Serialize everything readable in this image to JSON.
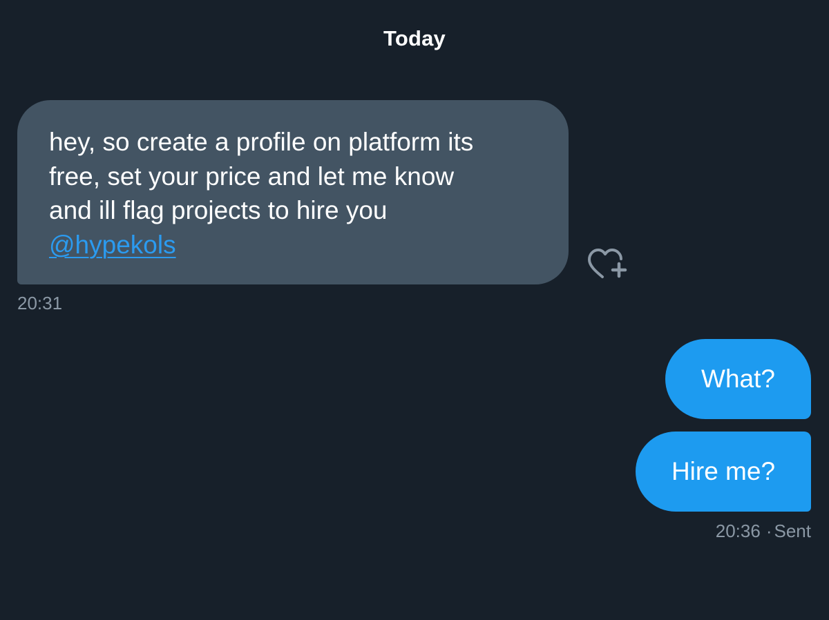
{
  "conversation": {
    "date_label": "Today",
    "messages": [
      {
        "direction": "incoming",
        "lines": [
          "hey, so create a profile on platform its",
          "free, set your price and let me know",
          "and ill flag projects to hire you"
        ],
        "mention": "@hypekols",
        "time": "20:31",
        "reaction_icon": "heart-plus-icon"
      },
      {
        "direction": "outgoing",
        "text": "What?"
      },
      {
        "direction": "outgoing",
        "text": "Hire me?",
        "time": "20:36",
        "separator": "·",
        "status": "Sent"
      }
    ]
  },
  "colors": {
    "background": "#17202a",
    "incoming_bubble": "#435463",
    "outgoing_bubble": "#1d9bf0",
    "link": "#2b9bf0",
    "muted_text": "#8b98a5"
  }
}
